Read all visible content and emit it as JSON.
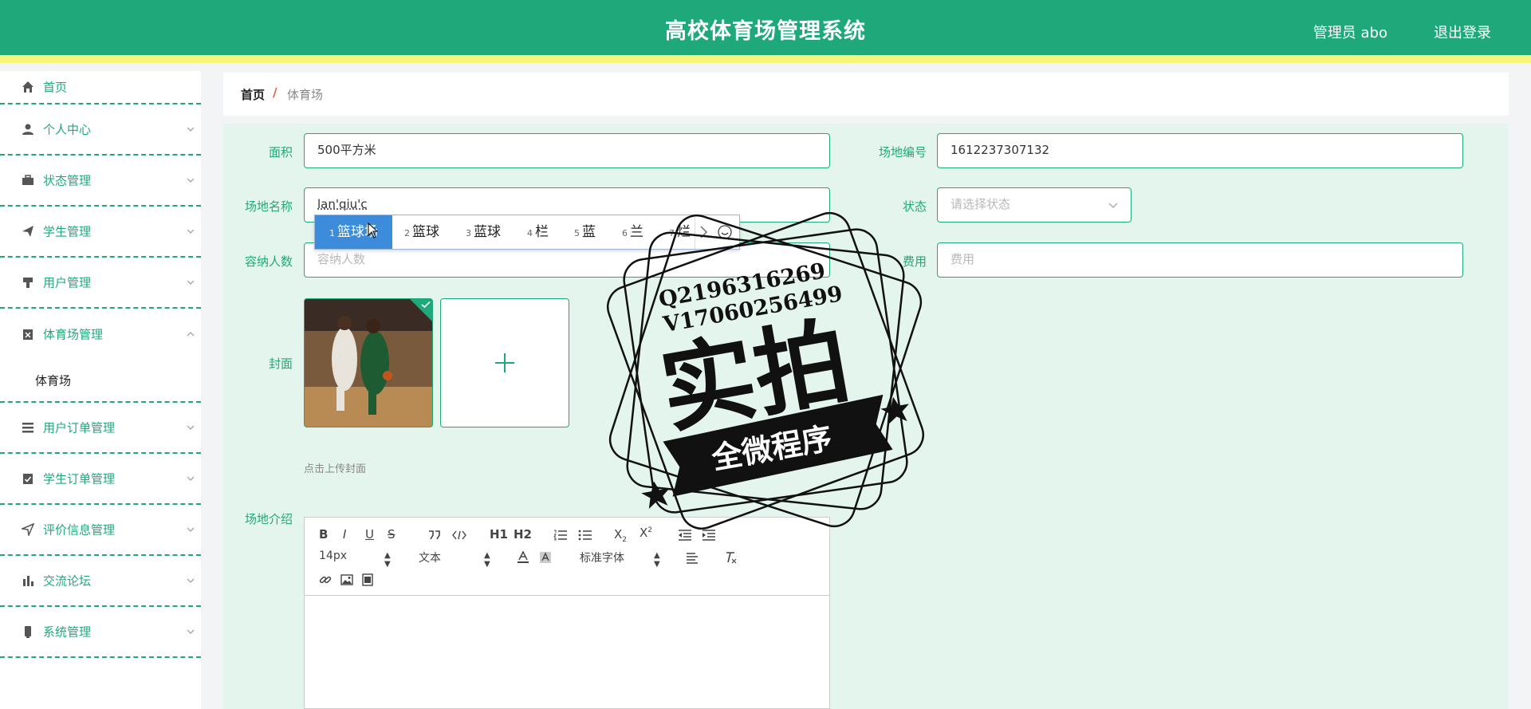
{
  "header": {
    "title": "高校体育场管理系统",
    "user": "管理员 abo",
    "logout": "退出登录"
  },
  "colors": {
    "primary": "#1fa97b",
    "accent": "#f5f67a",
    "panel": "#e4f5ee",
    "ime_select": "#3c8cdb"
  },
  "sidebar": {
    "items": [
      {
        "label": "首页",
        "icon": "home-icon"
      },
      {
        "label": "个人中心",
        "icon": "user-icon"
      },
      {
        "label": "状态管理",
        "icon": "briefcase-icon"
      },
      {
        "label": "学生管理",
        "icon": "paper-plane-icon"
      },
      {
        "label": "用户管理",
        "icon": "stamp-icon"
      },
      {
        "label": "体育场管理",
        "icon": "clipboard-x-icon",
        "open": true,
        "sub": [
          "体育场"
        ]
      },
      {
        "label": "用户订单管理",
        "icon": "list-icon"
      },
      {
        "label": "学生订单管理",
        "icon": "clipboard-check-icon"
      },
      {
        "label": "评价信息管理",
        "icon": "location-arrow-icon"
      },
      {
        "label": "交流论坛",
        "icon": "bar-chart-icon"
      },
      {
        "label": "系统管理",
        "icon": "device-icon"
      }
    ]
  },
  "breadcrumb": {
    "home": "首页",
    "sep": "/",
    "current": "体育场"
  },
  "form": {
    "area_label": "面积",
    "area_value": "500平方米",
    "code_label": "场地编号",
    "code_value": "1612237307132",
    "name_label": "场地名称",
    "name_value": "lan'qiu'c",
    "status_label": "状态",
    "status_placeholder": "请选择状态",
    "capacity_label": "容纳人数",
    "capacity_placeholder": "容纳人数",
    "fee_label": "费用",
    "fee_placeholder": "费用",
    "cover_label": "封面",
    "upload_hint": "点击上传封面",
    "intro_label": "场地介绍"
  },
  "ime": {
    "candidates": [
      {
        "n": "1",
        "text": "篮球场"
      },
      {
        "n": "2",
        "text": "篮球"
      },
      {
        "n": "3",
        "text": "蓝球"
      },
      {
        "n": "4",
        "text": "栏"
      },
      {
        "n": "5",
        "text": "蓝"
      },
      {
        "n": "6",
        "text": "兰"
      },
      {
        "n": "7",
        "text": "烂"
      }
    ]
  },
  "editor": {
    "font_size": "14px",
    "text_type": "文本",
    "font_family": "标准字体",
    "buttons": [
      "B",
      "I",
      "U",
      "S",
      "H1",
      "H2"
    ]
  },
  "stamp": {
    "line1": "Q2196316269",
    "line2": "V17060256499",
    "big": "实拍",
    "banner": "全微程序"
  }
}
